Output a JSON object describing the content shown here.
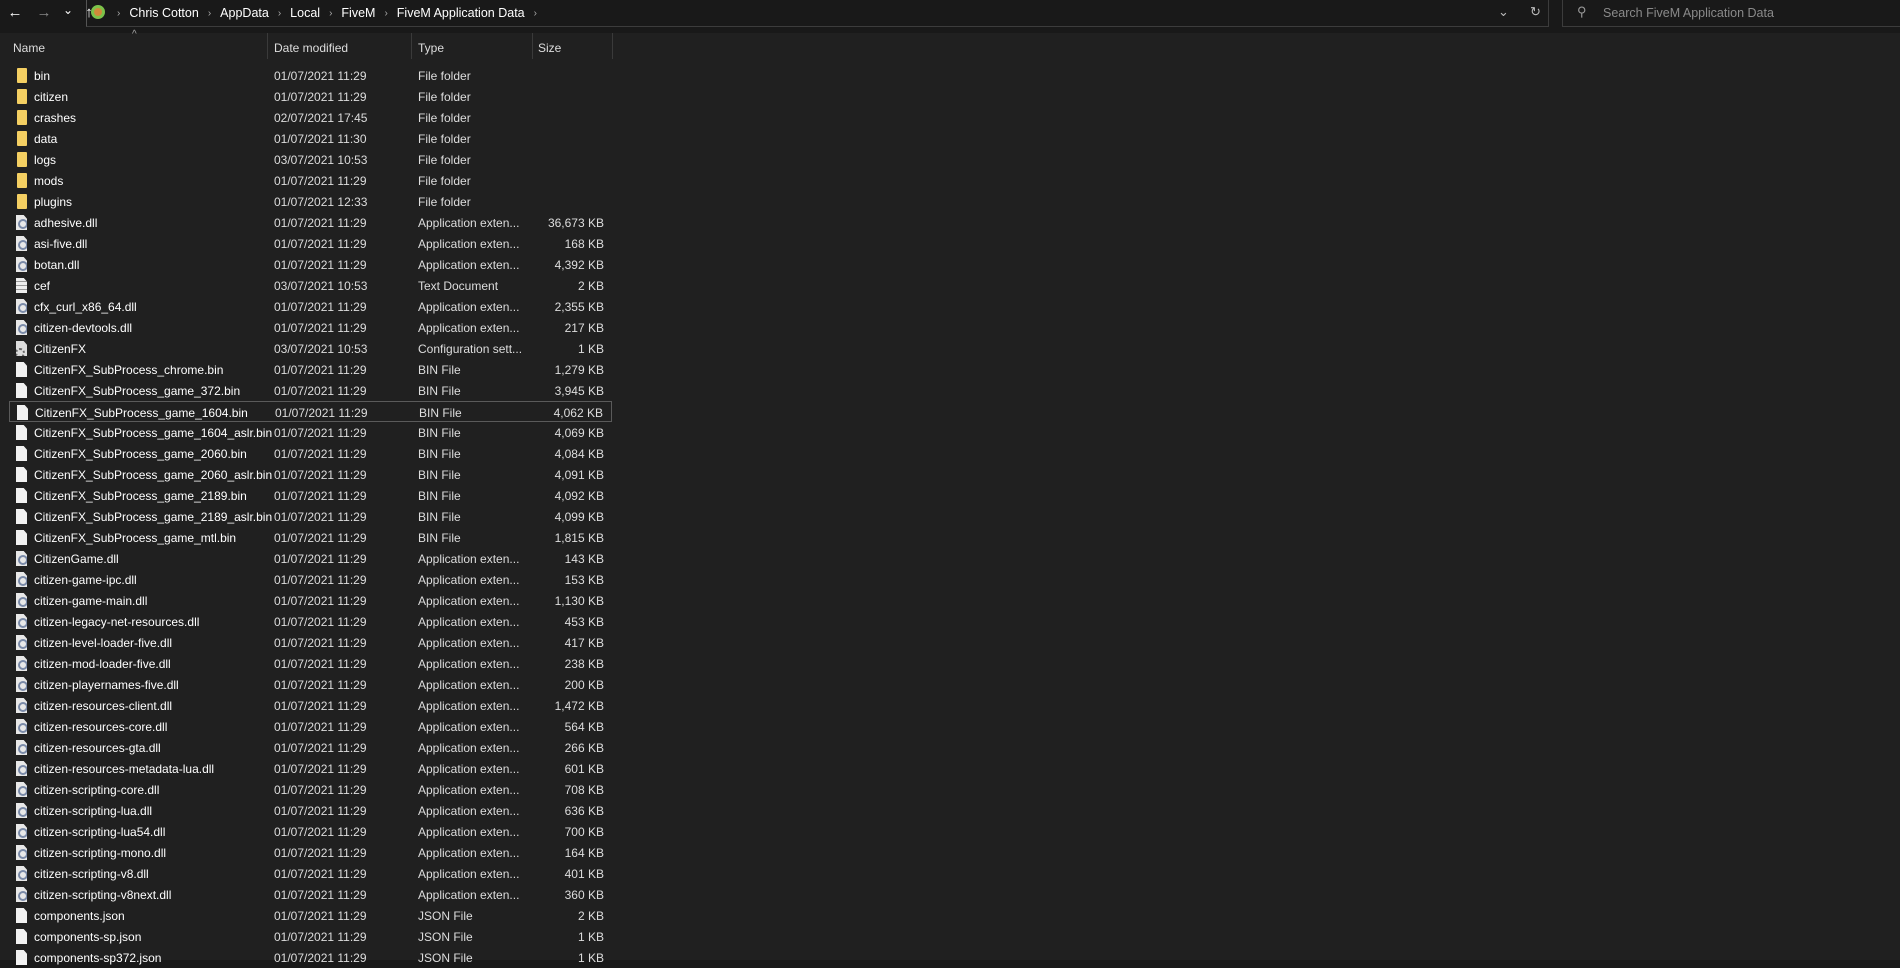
{
  "nav": {
    "back": "←",
    "forward": "→",
    "recent": "⌄",
    "up": "↑"
  },
  "breadcrumb": [
    "Chris Cotton",
    "AppData",
    "Local",
    "FiveM",
    "FiveM Application Data"
  ],
  "address": {
    "dropdown": "⌄",
    "refresh": "↻"
  },
  "search": {
    "placeholder": "Search FiveM Application Data"
  },
  "columns": {
    "name": "Name",
    "date": "Date modified",
    "type": "Type",
    "size": "Size"
  },
  "selected_index": 16,
  "files": [
    {
      "name": "bin",
      "date": "01/07/2021 11:29",
      "type": "File folder",
      "size": "",
      "icon": "folder"
    },
    {
      "name": "citizen",
      "date": "01/07/2021 11:29",
      "type": "File folder",
      "size": "",
      "icon": "folder"
    },
    {
      "name": "crashes",
      "date": "02/07/2021 17:45",
      "type": "File folder",
      "size": "",
      "icon": "folder"
    },
    {
      "name": "data",
      "date": "01/07/2021 11:30",
      "type": "File folder",
      "size": "",
      "icon": "folder"
    },
    {
      "name": "logs",
      "date": "03/07/2021 10:53",
      "type": "File folder",
      "size": "",
      "icon": "folder"
    },
    {
      "name": "mods",
      "date": "01/07/2021 11:29",
      "type": "File folder",
      "size": "",
      "icon": "folder"
    },
    {
      "name": "plugins",
      "date": "01/07/2021 12:33",
      "type": "File folder",
      "size": "",
      "icon": "folder"
    },
    {
      "name": "adhesive.dll",
      "date": "01/07/2021 11:29",
      "type": "Application exten...",
      "size": "36,673 KB",
      "icon": "dll"
    },
    {
      "name": "asi-five.dll",
      "date": "01/07/2021 11:29",
      "type": "Application exten...",
      "size": "168 KB",
      "icon": "dll"
    },
    {
      "name": "botan.dll",
      "date": "01/07/2021 11:29",
      "type": "Application exten...",
      "size": "4,392 KB",
      "icon": "dll"
    },
    {
      "name": "cef",
      "date": "03/07/2021 10:53",
      "type": "Text Document",
      "size": "2 KB",
      "icon": "txt"
    },
    {
      "name": "cfx_curl_x86_64.dll",
      "date": "01/07/2021 11:29",
      "type": "Application exten...",
      "size": "2,355 KB",
      "icon": "dll"
    },
    {
      "name": "citizen-devtools.dll",
      "date": "01/07/2021 11:29",
      "type": "Application exten...",
      "size": "217 KB",
      "icon": "dll"
    },
    {
      "name": "CitizenFX",
      "date": "03/07/2021 10:53",
      "type": "Configuration sett...",
      "size": "1 KB",
      "icon": "cfg"
    },
    {
      "name": "CitizenFX_SubProcess_chrome.bin",
      "date": "01/07/2021 11:29",
      "type": "BIN File",
      "size": "1,279 KB",
      "icon": "file"
    },
    {
      "name": "CitizenFX_SubProcess_game_372.bin",
      "date": "01/07/2021 11:29",
      "type": "BIN File",
      "size": "3,945 KB",
      "icon": "file"
    },
    {
      "name": "CitizenFX_SubProcess_game_1604.bin",
      "date": "01/07/2021 11:29",
      "type": "BIN File",
      "size": "4,062 KB",
      "icon": "file"
    },
    {
      "name": "CitizenFX_SubProcess_game_1604_aslr.bin",
      "date": "01/07/2021 11:29",
      "type": "BIN File",
      "size": "4,069 KB",
      "icon": "file"
    },
    {
      "name": "CitizenFX_SubProcess_game_2060.bin",
      "date": "01/07/2021 11:29",
      "type": "BIN File",
      "size": "4,084 KB",
      "icon": "file"
    },
    {
      "name": "CitizenFX_SubProcess_game_2060_aslr.bin",
      "date": "01/07/2021 11:29",
      "type": "BIN File",
      "size": "4,091 KB",
      "icon": "file"
    },
    {
      "name": "CitizenFX_SubProcess_game_2189.bin",
      "date": "01/07/2021 11:29",
      "type": "BIN File",
      "size": "4,092 KB",
      "icon": "file"
    },
    {
      "name": "CitizenFX_SubProcess_game_2189_aslr.bin",
      "date": "01/07/2021 11:29",
      "type": "BIN File",
      "size": "4,099 KB",
      "icon": "file"
    },
    {
      "name": "CitizenFX_SubProcess_game_mtl.bin",
      "date": "01/07/2021 11:29",
      "type": "BIN File",
      "size": "1,815 KB",
      "icon": "file"
    },
    {
      "name": "CitizenGame.dll",
      "date": "01/07/2021 11:29",
      "type": "Application exten...",
      "size": "143 KB",
      "icon": "dll"
    },
    {
      "name": "citizen-game-ipc.dll",
      "date": "01/07/2021 11:29",
      "type": "Application exten...",
      "size": "153 KB",
      "icon": "dll"
    },
    {
      "name": "citizen-game-main.dll",
      "date": "01/07/2021 11:29",
      "type": "Application exten...",
      "size": "1,130 KB",
      "icon": "dll"
    },
    {
      "name": "citizen-legacy-net-resources.dll",
      "date": "01/07/2021 11:29",
      "type": "Application exten...",
      "size": "453 KB",
      "icon": "dll"
    },
    {
      "name": "citizen-level-loader-five.dll",
      "date": "01/07/2021 11:29",
      "type": "Application exten...",
      "size": "417 KB",
      "icon": "dll"
    },
    {
      "name": "citizen-mod-loader-five.dll",
      "date": "01/07/2021 11:29",
      "type": "Application exten...",
      "size": "238 KB",
      "icon": "dll"
    },
    {
      "name": "citizen-playernames-five.dll",
      "date": "01/07/2021 11:29",
      "type": "Application exten...",
      "size": "200 KB",
      "icon": "dll"
    },
    {
      "name": "citizen-resources-client.dll",
      "date": "01/07/2021 11:29",
      "type": "Application exten...",
      "size": "1,472 KB",
      "icon": "dll"
    },
    {
      "name": "citizen-resources-core.dll",
      "date": "01/07/2021 11:29",
      "type": "Application exten...",
      "size": "564 KB",
      "icon": "dll"
    },
    {
      "name": "citizen-resources-gta.dll",
      "date": "01/07/2021 11:29",
      "type": "Application exten...",
      "size": "266 KB",
      "icon": "dll"
    },
    {
      "name": "citizen-resources-metadata-lua.dll",
      "date": "01/07/2021 11:29",
      "type": "Application exten...",
      "size": "601 KB",
      "icon": "dll"
    },
    {
      "name": "citizen-scripting-core.dll",
      "date": "01/07/2021 11:29",
      "type": "Application exten...",
      "size": "708 KB",
      "icon": "dll"
    },
    {
      "name": "citizen-scripting-lua.dll",
      "date": "01/07/2021 11:29",
      "type": "Application exten...",
      "size": "636 KB",
      "icon": "dll"
    },
    {
      "name": "citizen-scripting-lua54.dll",
      "date": "01/07/2021 11:29",
      "type": "Application exten...",
      "size": "700 KB",
      "icon": "dll"
    },
    {
      "name": "citizen-scripting-mono.dll",
      "date": "01/07/2021 11:29",
      "type": "Application exten...",
      "size": "164 KB",
      "icon": "dll"
    },
    {
      "name": "citizen-scripting-v8.dll",
      "date": "01/07/2021 11:29",
      "type": "Application exten...",
      "size": "401 KB",
      "icon": "dll"
    },
    {
      "name": "citizen-scripting-v8next.dll",
      "date": "01/07/2021 11:29",
      "type": "Application exten...",
      "size": "360 KB",
      "icon": "dll"
    },
    {
      "name": "components.json",
      "date": "01/07/2021 11:29",
      "type": "JSON File",
      "size": "2 KB",
      "icon": "file"
    },
    {
      "name": "components-sp.json",
      "date": "01/07/2021 11:29",
      "type": "JSON File",
      "size": "1 KB",
      "icon": "file"
    },
    {
      "name": "components-sp372.json",
      "date": "01/07/2021 11:29",
      "type": "JSON File",
      "size": "1 KB",
      "icon": "file"
    }
  ]
}
